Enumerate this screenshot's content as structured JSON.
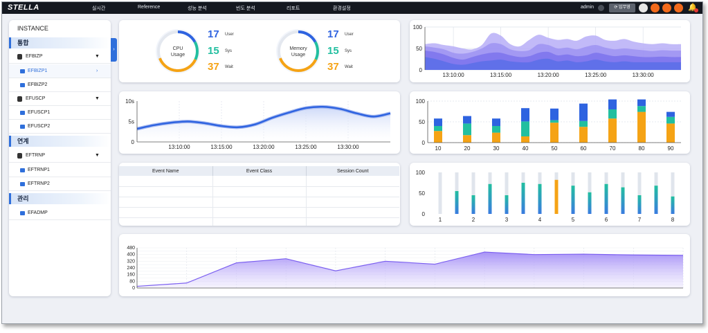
{
  "app": {
    "logo_text": "STELLA"
  },
  "menu": {
    "items": [
      "실시간",
      "Reference",
      "성능 분석",
      "빈도 분석",
      "리포트",
      "환경설정"
    ]
  },
  "user": {
    "name": "admin",
    "op_mode_label": "⟳ 입무영",
    "icon_colors": [
      "#e6e6e6",
      "#f26a1b",
      "#f26a1b",
      "#f26a1b"
    ]
  },
  "sidebar": {
    "title": "INSTANCE",
    "groups": [
      {
        "label": "통합",
        "instances": [
          {
            "name": "EFBIZP",
            "expanded": true,
            "children": [
              {
                "name": "EFBIZP1",
                "active": true
              },
              {
                "name": "EFBIZP2",
                "active": false
              }
            ]
          },
          {
            "name": "EFUSCP",
            "expanded": true,
            "children": [
              {
                "name": "EFUSCP1",
                "active": false
              },
              {
                "name": "EFUSCP2",
                "active": false
              }
            ]
          }
        ]
      },
      {
        "label": "연계",
        "instances": [
          {
            "name": "EFTRNP",
            "expanded": true,
            "children": [
              {
                "name": "EFTRNP1",
                "active": false
              },
              {
                "name": "EFTRNP2",
                "active": false
              }
            ]
          }
        ]
      },
      {
        "label": "관리",
        "instances": [
          {
            "name": "EFADMP",
            "children": []
          }
        ]
      }
    ]
  },
  "gauges": [
    {
      "label": "CPU\nUsage",
      "user": 17,
      "sys": 15,
      "wait": 37,
      "user_label": "User",
      "sys_label": "Sys",
      "wait_label": "Wait"
    },
    {
      "label": "Memory\nUsage",
      "user": 17,
      "sys": 15,
      "wait": 37,
      "user_label": "User",
      "sys_label": "Sys",
      "wait_label": "Wait"
    }
  ],
  "colors": {
    "user": "#2e63e0",
    "sys": "#22bfa0",
    "wait": "#f5a315",
    "purple": "#7b5ff0",
    "grid": "#dde2ea"
  },
  "chart_data": [
    {
      "id": "area-waves",
      "type": "area",
      "x": [
        "13:07:00",
        "13:08:00",
        "13:09:00",
        "13:10:00",
        "13:11:00",
        "13:12:00",
        "13:13:00",
        "13:14:00",
        "13:15:00",
        "13:16:00",
        "13:17:00",
        "13:18:00",
        "13:19:00",
        "13:20:00",
        "13:21:00",
        "13:22:00",
        "13:23:00",
        "13:24:00",
        "13:25:00",
        "13:26:00",
        "13:27:00",
        "13:28:00",
        "13:29:00",
        "13:30:00",
        "13:31:00",
        "13:32:00",
        "13:33:00",
        "13:34:00"
      ],
      "x_ticks": [
        "13:10:00",
        "13:15:00",
        "13:20:00",
        "13:25:00",
        "13:30:00"
      ],
      "ylim": [
        0,
        100
      ],
      "y_ticks": [
        0,
        50,
        100
      ],
      "series": [
        {
          "values": [
            60,
            62,
            58,
            55,
            50,
            48,
            58,
            85,
            80,
            60,
            55,
            70,
            82,
            75,
            70,
            72,
            68,
            78,
            80,
            70,
            68,
            72,
            66,
            62,
            60,
            62,
            60,
            60
          ],
          "color": "#b7aef7"
        },
        {
          "values": [
            55,
            52,
            48,
            40,
            38,
            42,
            50,
            62,
            60,
            48,
            44,
            46,
            60,
            58,
            50,
            52,
            48,
            54,
            58,
            52,
            48,
            50,
            48,
            46,
            44,
            46,
            45,
            45
          ],
          "color": "#9e93f2"
        },
        {
          "values": [
            45,
            42,
            36,
            28,
            24,
            30,
            36,
            40,
            40,
            34,
            30,
            32,
            40,
            42,
            34,
            36,
            32,
            34,
            40,
            36,
            32,
            34,
            32,
            30,
            30,
            31,
            30,
            30
          ],
          "color": "#7d73ec"
        },
        {
          "values": [
            30,
            26,
            20,
            14,
            12,
            16,
            20,
            22,
            24,
            20,
            18,
            18,
            24,
            26,
            20,
            22,
            18,
            20,
            24,
            20,
            18,
            20,
            18,
            18,
            18,
            18,
            18,
            18
          ],
          "color": "#5a6fe8"
        }
      ]
    },
    {
      "id": "line-smooth",
      "type": "line",
      "x": [
        "13:05:00",
        "13:07:00",
        "13:09:00",
        "13:11:00",
        "13:13:00",
        "13:15:00",
        "13:17:00",
        "13:19:00",
        "13:21:00",
        "13:23:00",
        "13:25:00",
        "13:27:00",
        "13:29:00",
        "13:31:00",
        "13:33:00",
        "13:35:00"
      ],
      "x_ticks": [
        "13:10:00",
        "13:15:00",
        "13:20:00",
        "13:25:00",
        "13:30:00"
      ],
      "y_ticks": [
        "0",
        "5s",
        "10s"
      ],
      "ylim": [
        0,
        10
      ],
      "series": [
        {
          "values": [
            3.2,
            4.1,
            4.7,
            5.0,
            4.6,
            3.9,
            3.6,
            4.3,
            5.9,
            7.2,
            8.3,
            8.6,
            8.1,
            7.0,
            6.2,
            7.0
          ],
          "color": "#2e63e0"
        }
      ]
    },
    {
      "id": "stacked-bars",
      "type": "bar",
      "categories": [
        "10",
        "20",
        "30",
        "40",
        "50",
        "60",
        "70",
        "80",
        "90"
      ],
      "ylim": [
        0,
        100
      ],
      "y_ticks": [
        0,
        50,
        100
      ],
      "series": [
        {
          "name": "Wait",
          "values": [
            28,
            18,
            24,
            15,
            48,
            38,
            58,
            74,
            46
          ],
          "color": "#f5a315"
        },
        {
          "name": "Sys",
          "values": [
            12,
            28,
            16,
            36,
            6,
            14,
            22,
            14,
            16
          ],
          "color": "#22bfa0"
        },
        {
          "name": "User",
          "values": [
            18,
            18,
            18,
            32,
            28,
            42,
            24,
            16,
            12
          ],
          "color": "#2e63e0"
        }
      ]
    },
    {
      "id": "progress-bars",
      "type": "bar",
      "categories": [
        "1",
        "",
        "2",
        "",
        "3",
        "",
        "4",
        "",
        "5",
        "",
        "6",
        "",
        "7",
        "",
        "8"
      ],
      "x_labels": [
        "1",
        "2",
        "3",
        "4",
        "5",
        "6",
        "7",
        "8"
      ],
      "ylim": [
        0,
        100
      ],
      "y_ticks": [
        0,
        50,
        100
      ],
      "values": [
        0,
        55,
        45,
        72,
        45,
        75,
        72,
        82,
        68,
        52,
        72,
        64,
        45,
        68,
        42
      ],
      "highlight_index": 7
    },
    {
      "id": "purple-area",
      "type": "area",
      "x": [
        0,
        1,
        2,
        3,
        4,
        5,
        6,
        7,
        8,
        9,
        10,
        11
      ],
      "ylim": [
        0,
        480
      ],
      "y_ticks": [
        0,
        40,
        80,
        120,
        160,
        200,
        240,
        280,
        320,
        360,
        400,
        440,
        480
      ],
      "y_tick_labels": [
        "0",
        "80",
        "160",
        "240",
        "320",
        "400",
        "480"
      ],
      "series": [
        {
          "values": [
            20,
            60,
            300,
            350,
            205,
            320,
            285,
            430,
            400,
            405,
            395,
            390
          ],
          "color": "#7b5ff0"
        }
      ]
    }
  ],
  "events": {
    "columns": [
      "Event Name",
      "Event Class",
      "Session Count"
    ],
    "rows": [
      [
        "",
        "",
        ""
      ],
      [
        "",
        "",
        ""
      ],
      [
        "",
        "",
        ""
      ],
      [
        "",
        "",
        ""
      ],
      [
        "",
        "",
        ""
      ]
    ]
  }
}
